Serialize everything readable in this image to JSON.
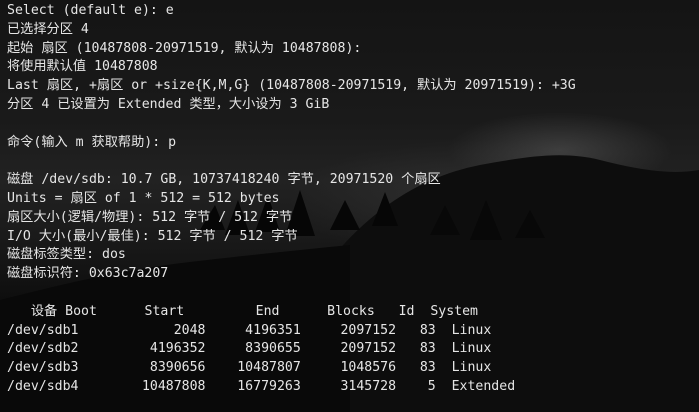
{
  "terminal": {
    "section1": {
      "lines": [
        "Select (default e): e",
        "已选择分区 4",
        "起始 扇区 (10487808-20971519, 默认为 10487808):",
        "将使用默认值 10487808",
        "Last 扇区, +扇区 or +size{K,M,G} (10487808-20971519, 默认为 20971519): +3G",
        "分区 4 已设置为 Extended 类型，大小设为 3 GiB"
      ]
    },
    "section2": {
      "lines": [
        "命令(输入 m 获取帮助): p"
      ]
    },
    "section3": {
      "lines": [
        "磁盘 /dev/sdb: 10.7 GB, 10737418240 字节, 20971520 个扇区",
        "Units = 扇区 of 1 * 512 = 512 bytes",
        "扇区大小(逻辑/物理): 512 字节 / 512 字节",
        "I/O 大小(最小/最佳): 512 字节 / 512 字节",
        "磁盘标签类型: dos",
        "磁盘标识符: 0x63c7a207"
      ]
    },
    "partition_table": {
      "header": "   设备 Boot      Start         End      Blocks   Id  System",
      "rows": [
        "/dev/sdb1            2048     4196351     2097152   83  Linux",
        "/dev/sdb2         4196352     8390655     2097152   83  Linux",
        "/dev/sdb3         8390656    10487807     1048576   83  Linux",
        "/dev/sdb4        10487808    16779263     3145728    5  Extended"
      ]
    }
  }
}
